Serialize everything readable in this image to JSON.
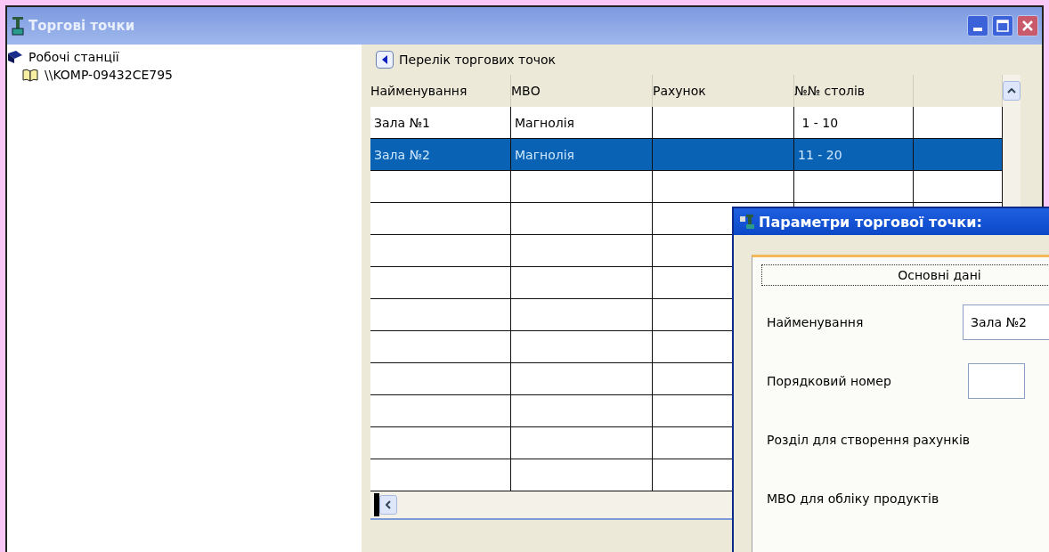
{
  "window": {
    "title": "Торгові точки"
  },
  "tree": [
    {
      "label": "Робочі станції",
      "children": [
        {
          "label": "\\\\KOMP-09432CE795"
        }
      ]
    }
  ],
  "list_panel": {
    "title": "Перелік торгових точок"
  },
  "table": {
    "columns": [
      "Найменування",
      "МВО",
      "Рахунок",
      "№№ столів"
    ],
    "rows": [
      {
        "cells": [
          "Зала №1",
          "Магнолія",
          "",
          " 1 - 10"
        ],
        "selected": false
      },
      {
        "cells": [
          "Зала №2",
          "Магнолія",
          "",
          "11 - 20"
        ],
        "selected": true
      }
    ]
  },
  "dialog": {
    "title": "Параметри торгової точки:",
    "tab": "Основні дані",
    "fields": [
      {
        "label": "Найменування",
        "kind": "wide",
        "value": "Зала №2"
      },
      {
        "label": "Порядковий номер",
        "kind": "small"
      },
      {
        "label": "Розділ для створення рахунків",
        "kind": "none"
      },
      {
        "label": "МВО для обліку продуктів",
        "kind": "none"
      }
    ]
  }
}
